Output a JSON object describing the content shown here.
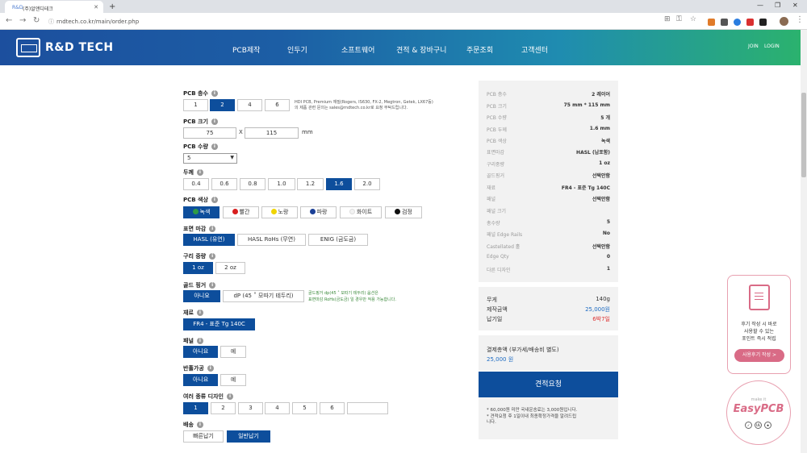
{
  "browser": {
    "tab_title": "(주)알앤디테크",
    "url": "rndtech.co.kr/main/order.php"
  },
  "header": {
    "logo": "R&D TECH",
    "nav": [
      "PCB제작",
      "인두기",
      "소프트웨어",
      "견적 & 장바구니",
      "주문조회",
      "고객센터"
    ],
    "join": "JOIN",
    "login": "LOGIN"
  },
  "form": {
    "layers": {
      "label": "PCB 층수",
      "options": [
        "1",
        "2",
        "4",
        "6"
      ],
      "selected": 1,
      "note1": "HDI PCB, Premium 재질(Rogers, IS630, FX-2, Megtron, Getek, LX67등)",
      "note2": "의 제품 관련 문의는 sales@rndtech.co.kr로 요청 부탁드립니다."
    },
    "size": {
      "label": "PCB 크기",
      "w": "75",
      "x": "X",
      "h": "115",
      "unit": "mm"
    },
    "qty": {
      "label": "PCB 수량",
      "value": "5"
    },
    "thickness": {
      "label": "두께",
      "options": [
        "0.4",
        "0.6",
        "0.8",
        "1.0",
        "1.2",
        "1.6",
        "2.0"
      ],
      "selected": 5
    },
    "color": {
      "label": "PCB 색상",
      "options": [
        {
          "name": "녹색",
          "dot": "#2e9b45"
        },
        {
          "name": "빨간",
          "dot": "#d81e1e"
        },
        {
          "name": "노랑",
          "dot": "#f0d400"
        },
        {
          "name": "파랑",
          "dot": "#1a3f96"
        },
        {
          "name": "화이트",
          "dot": "#f2f2f2"
        },
        {
          "name": "검정",
          "dot": "#111111"
        }
      ],
      "selected": 0
    },
    "finish": {
      "label": "표면 마감",
      "options": [
        "HASL (유연)",
        "HASL RoHs (무연)",
        "ENIG (금도금)"
      ],
      "selected": 0
    },
    "copper": {
      "label": "구리 중량",
      "options": [
        "1 oz",
        "2 oz"
      ],
      "selected": 0
    },
    "gold": {
      "label": "골드 핑거",
      "options": [
        "아니요",
        "dP (45 ˚ 모따기 테두리)"
      ],
      "selected": 0,
      "note1": "골드핑거 dp(45 ˚ 모따기 테두리) 옵션은",
      "note2": "표면마감 RoHs(금도금) 일 경우만 적용 가능합니다."
    },
    "material": {
      "label": "재료",
      "value": "FR4 - 표준 Tg 140C"
    },
    "panel": {
      "label": "패널",
      "options": [
        "아니요",
        "예"
      ],
      "selected": 0
    },
    "halfhole": {
      "label": "반홀가공",
      "options": [
        "아니요",
        "예"
      ],
      "selected": 0
    },
    "designs": {
      "label": "여러 종류 디자인",
      "options": [
        "1",
        "2",
        "3",
        "4",
        "5",
        "6",
        ""
      ],
      "selected": 0
    },
    "shipping": {
      "label": "배송",
      "options": [
        "빠른납기",
        "일반납기"
      ],
      "selected": 1
    }
  },
  "summary": {
    "rows": [
      {
        "k": "PCB 층수",
        "v": "2 레이어"
      },
      {
        "k": "PCB 크기",
        "v": "75 mm * 115 mm"
      },
      {
        "k": "PCB 수량",
        "v": "5 개"
      },
      {
        "k": "PCB 두께",
        "v": "1.6 mm"
      },
      {
        "k": "PCB 색상",
        "v": "녹색"
      },
      {
        "k": "표면마감",
        "v": "HASL (납포함)"
      },
      {
        "k": "구리중량",
        "v": "1 oz"
      },
      {
        "k": "골드핑거",
        "v": "선택안함"
      },
      {
        "k": "재료",
        "v": "FR4 - 표준 Tg 140C"
      },
      {
        "k": "패널",
        "v": "선택안함"
      },
      {
        "k": "패널 크기",
        "v": ""
      },
      {
        "k": "총수량",
        "v": "5"
      },
      {
        "k": "패널 Edge Rails",
        "v": "No"
      },
      {
        "k": "Castellated 홀",
        "v": "선택안함"
      },
      {
        "k": "Edge Qty",
        "v": "0"
      },
      {
        "k": "다른 디자인",
        "v": "1"
      }
    ],
    "weight_label": "무게",
    "weight": "140g",
    "price_label": "제작금액",
    "price": "25,000원",
    "lead_label": "납기일",
    "lead": "6박7일",
    "total_label": "결제총액 (부가세/배송비 별도)",
    "total": "25,000 원",
    "quote_button": "견적요청",
    "foot1": "* 60,000원 미만 국내운송료는 3,000원입니다.",
    "foot2": "* 견적요청 후 1일이내 최종확정가격을 알려드립",
    "foot3": "니다."
  },
  "review": {
    "line1": "후기 작성 시 바로",
    "line2": "사용할 수 있는",
    "line3": "포인트 즉시 적립",
    "button": "사용후기 작성 >"
  },
  "easypcb": {
    "make": "make it",
    "name": "EasyPCB"
  }
}
